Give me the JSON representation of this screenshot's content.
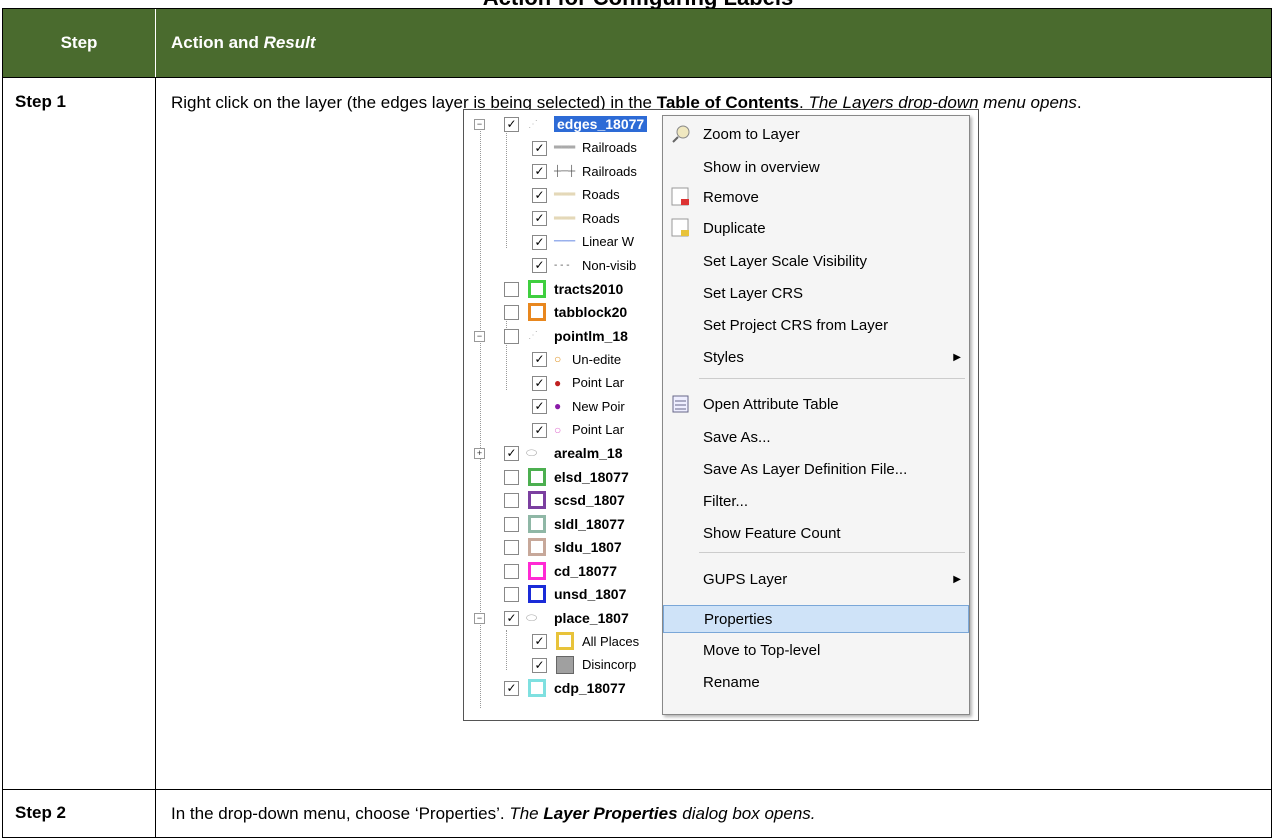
{
  "page_title": "Action for Configuring Labels",
  "header": {
    "step": "Step",
    "action": "Action and ",
    "result": "Result"
  },
  "step1": {
    "label": "Step 1",
    "t1": "Right click on the layer (the edges layer is being selected) in the ",
    "b1": "Table of Contents",
    "t2": ". ",
    "i1": "The Layers drop-down menu opens",
    "t3": "."
  },
  "step2": {
    "label": "Step 2",
    "t1": "In the drop-down menu, choose ‘Properties’. ",
    "i1": "The ",
    "bi1": "Layer Properties",
    "i2": " dialog box opens."
  },
  "tree": [
    {
      "label": "edges_18077",
      "bold": true,
      "checked": true
    },
    {
      "label": "Railroads",
      "checked": true
    },
    {
      "label": "Railroads",
      "checked": true
    },
    {
      "label": "Roads",
      "checked": true
    },
    {
      "label": "Roads",
      "checked": true
    },
    {
      "label": "Linear W",
      "checked": true
    },
    {
      "label": "Non-visib",
      "checked": true
    },
    {
      "label": "tracts2010",
      "bold": true,
      "checked": false
    },
    {
      "label": "tabblock20",
      "bold": true,
      "checked": false
    },
    {
      "label": "pointlm_18",
      "bold": true,
      "checked": false
    },
    {
      "label": "Un-edite",
      "checked": true
    },
    {
      "label": "Point Lar",
      "checked": true
    },
    {
      "label": "New Poir",
      "checked": true
    },
    {
      "label": "Point Lar",
      "checked": true
    },
    {
      "label": "arealm_18",
      "bold": true,
      "checked": true
    },
    {
      "label": "elsd_18077",
      "bold": true,
      "checked": false
    },
    {
      "label": "scsd_1807",
      "bold": true,
      "checked": false
    },
    {
      "label": "sldl_18077",
      "bold": true,
      "checked": false
    },
    {
      "label": "sldu_1807",
      "bold": true,
      "checked": false
    },
    {
      "label": "cd_18077",
      "bold": true,
      "checked": false
    },
    {
      "label": "unsd_1807",
      "bold": true,
      "checked": false
    },
    {
      "label": "place_1807",
      "bold": true,
      "checked": true
    },
    {
      "label": "All Places",
      "checked": true
    },
    {
      "label": "Disincorp",
      "checked": true
    },
    {
      "label": "cdp_18077",
      "bold": true,
      "checked": true
    }
  ],
  "menu": [
    "Zoom to Layer",
    "Show in overview",
    "Remove",
    "Duplicate",
    "Set Layer Scale Visibility",
    "Set Layer CRS",
    "Set Project CRS from Layer",
    "Styles",
    "Open Attribute Table",
    "Save As...",
    "Save As Layer Definition File...",
    "Filter...",
    "Show Feature Count",
    "GUPS Layer",
    "Properties",
    "Move to Top-level",
    "Rename"
  ],
  "colors": {
    "header_bg": "#4a6b2e",
    "swatch_tracts": "#3fcf3f",
    "swatch_tabblock": "#e8871e",
    "swatch_elsd": "#4caf50",
    "swatch_scsd": "#7b3fa0",
    "swatch_sldl": "#8fb7a6",
    "swatch_sldu": "#c7a89a",
    "swatch_cd": "#ff2ad4",
    "swatch_unsd": "#1a2bd8",
    "swatch_allplaces": "#e8c33a",
    "swatch_disincorp": "#a0a0a0",
    "swatch_cdp": "#7fe0e0",
    "menu_highlight": "#cfe3f8"
  }
}
